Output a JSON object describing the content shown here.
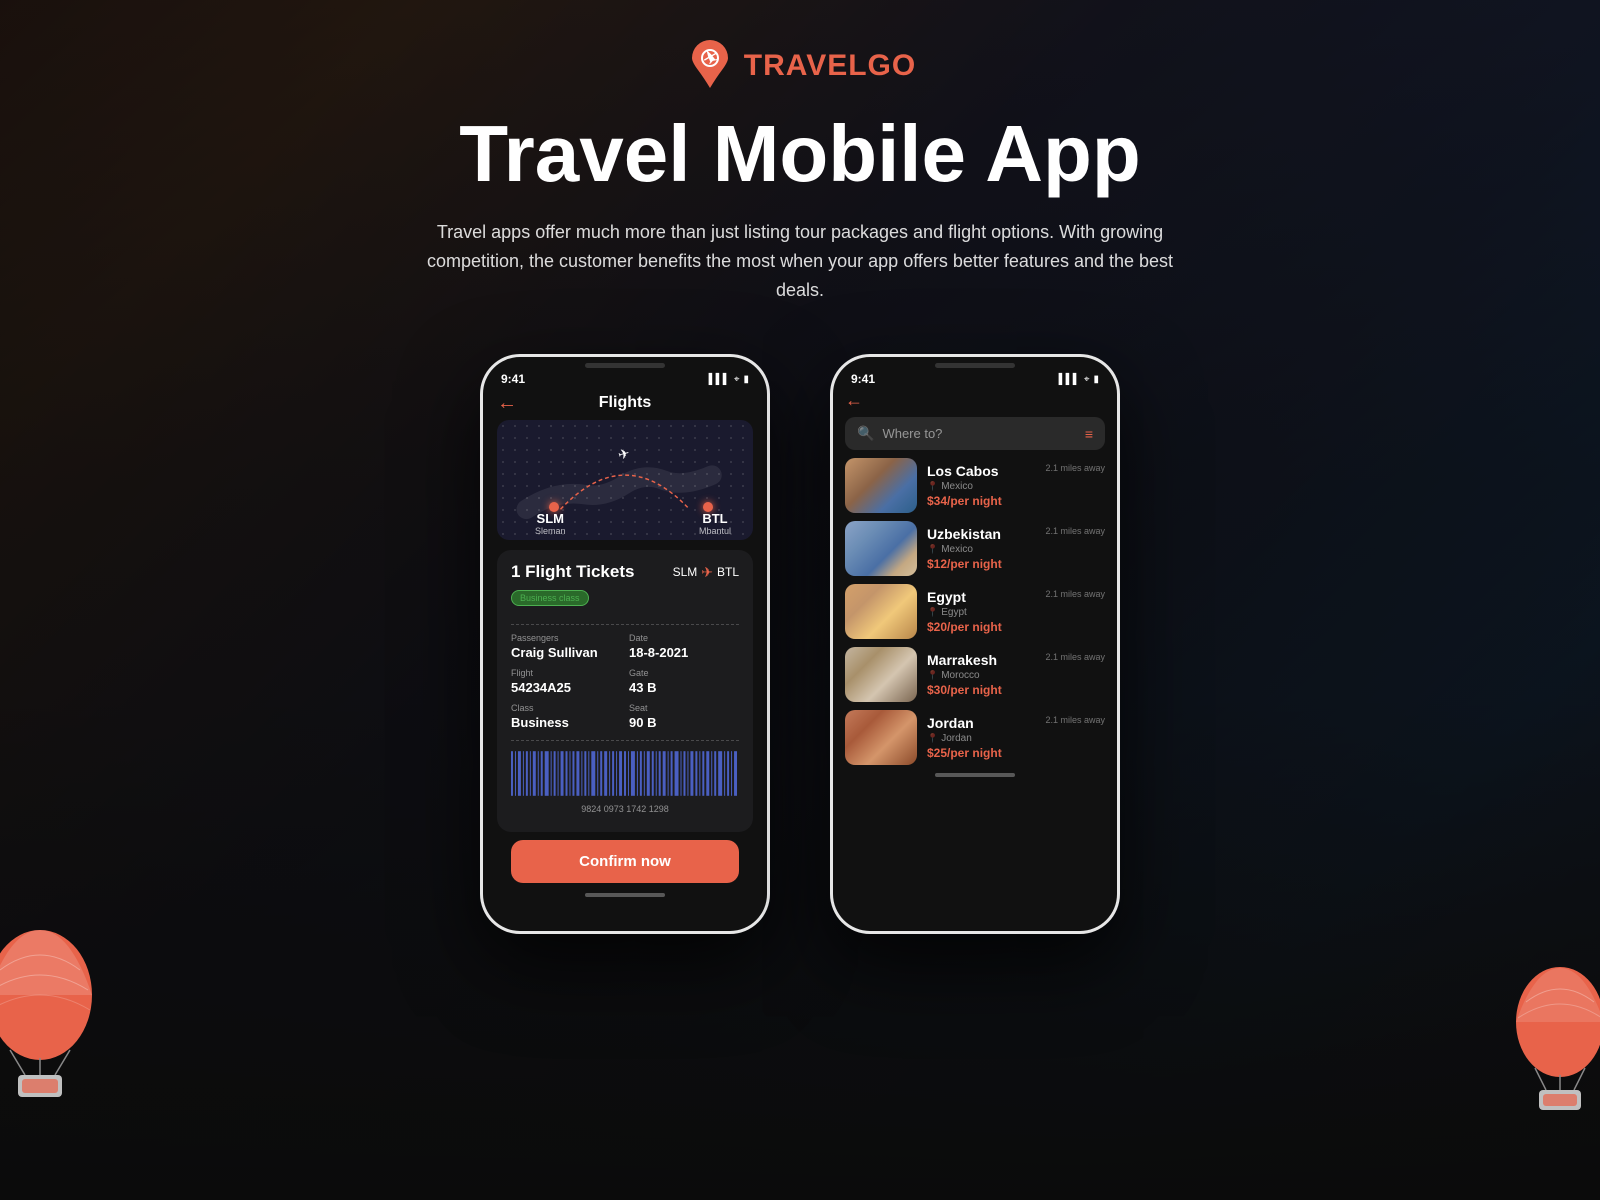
{
  "brand": {
    "name_part1": "TRAVEL",
    "name_part2": "GO"
  },
  "hero": {
    "title": "Travel Mobile App",
    "subtitle": "Travel apps offer much more than just listing tour packages and flight options. With growing competition, the customer benefits the most when your app offers better features and the best deals."
  },
  "phone1": {
    "status_time": "9:41",
    "back_label": "←",
    "title": "Flights",
    "map": {
      "from_code": "SLM",
      "from_city": "Sleman",
      "to_code": "BTL",
      "to_city": "Mbantul"
    },
    "ticket": {
      "flight_count": "1 Flight Tickets",
      "route_from": "SLM",
      "route_to": "BTL",
      "class_badge": "Business class",
      "fields": [
        {
          "label": "Passengers",
          "value": "Craig Sullivan"
        },
        {
          "label": "Date",
          "value": "18-8-2021"
        },
        {
          "label": "Flight",
          "value": "54234A25"
        },
        {
          "label": "Gate",
          "value": "43 B"
        },
        {
          "label": "Class",
          "value": "Business"
        },
        {
          "label": "Seat",
          "value": "90 B"
        }
      ],
      "barcode_number": "9824 0973 1742 1298"
    },
    "confirm_button": "Confirm now"
  },
  "phone2": {
    "status_time": "9:41",
    "back_label": "←",
    "search_placeholder": "Where to?",
    "destinations": [
      {
        "name": "Los Cabos",
        "country": "Mexico",
        "distance": "2.1 miles away",
        "price": "$34/per night",
        "thumb_class": "thumb-loscabos"
      },
      {
        "name": "Uzbekistan",
        "country": "Mexico",
        "distance": "2.1 miles away",
        "price": "$12/per night",
        "thumb_class": "thumb-uzbekistan"
      },
      {
        "name": "Egypt",
        "country": "Egypt",
        "distance": "2.1 miles away",
        "price": "$20/per night",
        "thumb_class": "thumb-egypt"
      },
      {
        "name": "Marrakesh",
        "country": "Morocco",
        "distance": "2.1 miles away",
        "price": "$30/per night",
        "thumb_class": "thumb-marrakesh"
      },
      {
        "name": "Jordan",
        "country": "Jordan",
        "distance": "2.1 miles away",
        "price": "$25/per night",
        "thumb_class": "thumb-jordan"
      }
    ]
  },
  "colors": {
    "accent": "#e8634a",
    "dark_bg": "#111111",
    "card_bg": "#1c1c1e"
  }
}
